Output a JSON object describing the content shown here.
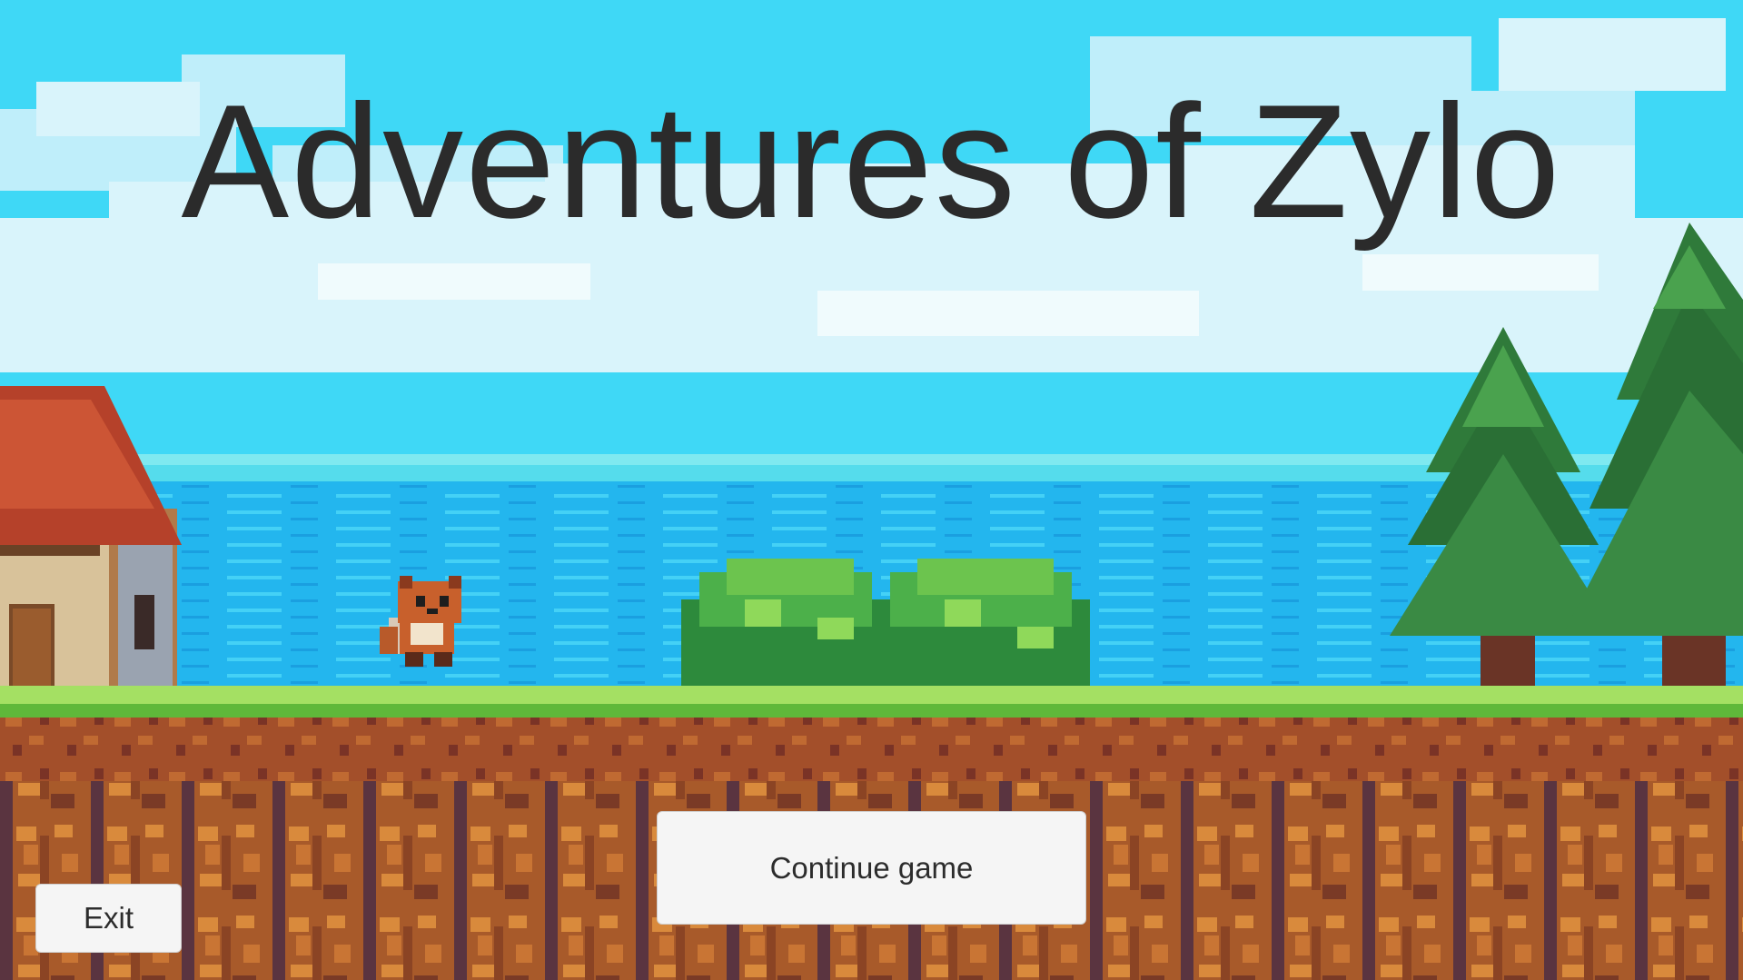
{
  "game": {
    "title": "Adventures of Zylo"
  },
  "menu": {
    "continue_label": "Continue game",
    "exit_label": "Exit"
  },
  "scene": {
    "objects": [
      "cottage",
      "fox-character",
      "bush-left",
      "bush-right",
      "pine-tree-left",
      "pine-tree-right"
    ]
  },
  "colors": {
    "sky": "#3fd8f6",
    "cloud": "#d9f4fb",
    "sea": "#27b9f0",
    "grass": "#8fd94c",
    "dirt": "#a85a2a",
    "dirt_dark": "#5a3440",
    "title_text": "#2b2b2b",
    "button_bg": "#f5f5f5"
  }
}
